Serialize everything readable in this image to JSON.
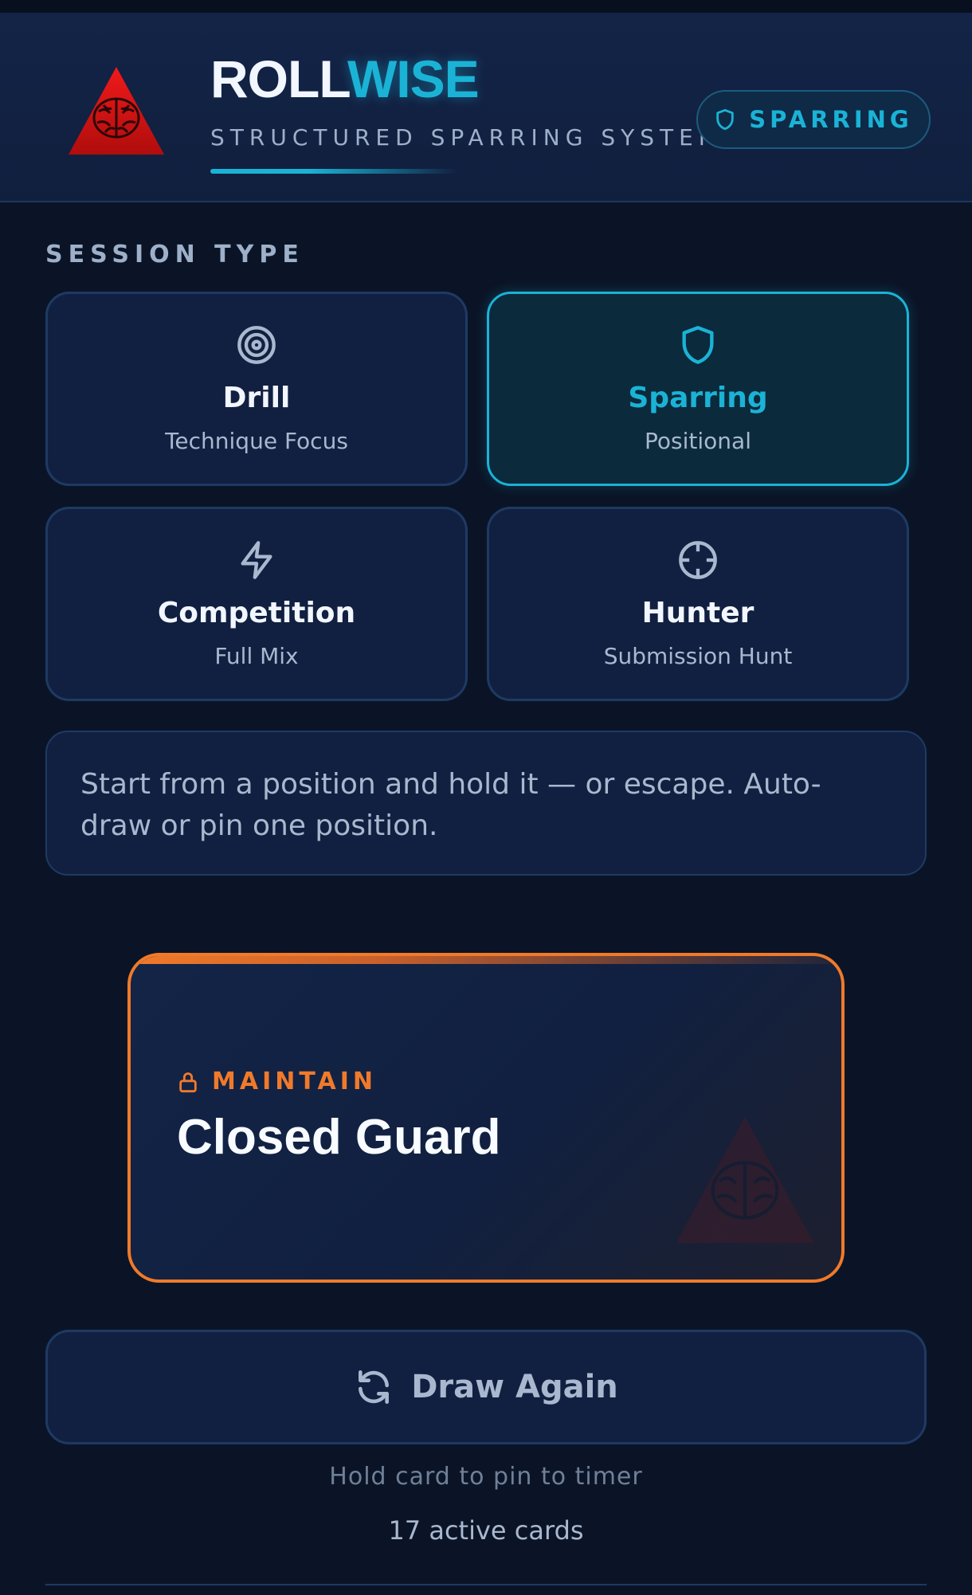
{
  "header": {
    "brand_part1": "ROLL",
    "brand_part2": "WISE",
    "tagline": "STRUCTURED SPARRING SYSTEM",
    "logo_icon": "brain-triangle-icon",
    "mode_badge": {
      "icon": "shield-icon",
      "label": "SPARRING"
    }
  },
  "session": {
    "section_label": "SESSION TYPE",
    "types": [
      {
        "icon": "target-icon",
        "title": "Drill",
        "subtitle": "Technique Focus",
        "selected": false
      },
      {
        "icon": "shield-icon",
        "title": "Sparring",
        "subtitle": "Positional",
        "selected": true
      },
      {
        "icon": "lightning-icon",
        "title": "Competition",
        "subtitle": "Full Mix",
        "selected": false
      },
      {
        "icon": "crosshair-icon",
        "title": "Hunter",
        "subtitle": "Submission Hunt",
        "selected": false
      }
    ],
    "description": "Start from a position and hold it — or escape. Auto-draw or pin one position."
  },
  "position_card": {
    "label": "MAINTAIN",
    "label_icon": "lock-icon",
    "name": "Closed Guard"
  },
  "actions": {
    "draw_label": "Draw Again",
    "draw_icon": "refresh-icon",
    "hint": "Hold card to pin to timer",
    "active_cards": "17 active cards"
  },
  "colors": {
    "accent": "#1ab3d6",
    "warning": "#f07a2a",
    "background": "#0b1426",
    "card": "#112040"
  }
}
